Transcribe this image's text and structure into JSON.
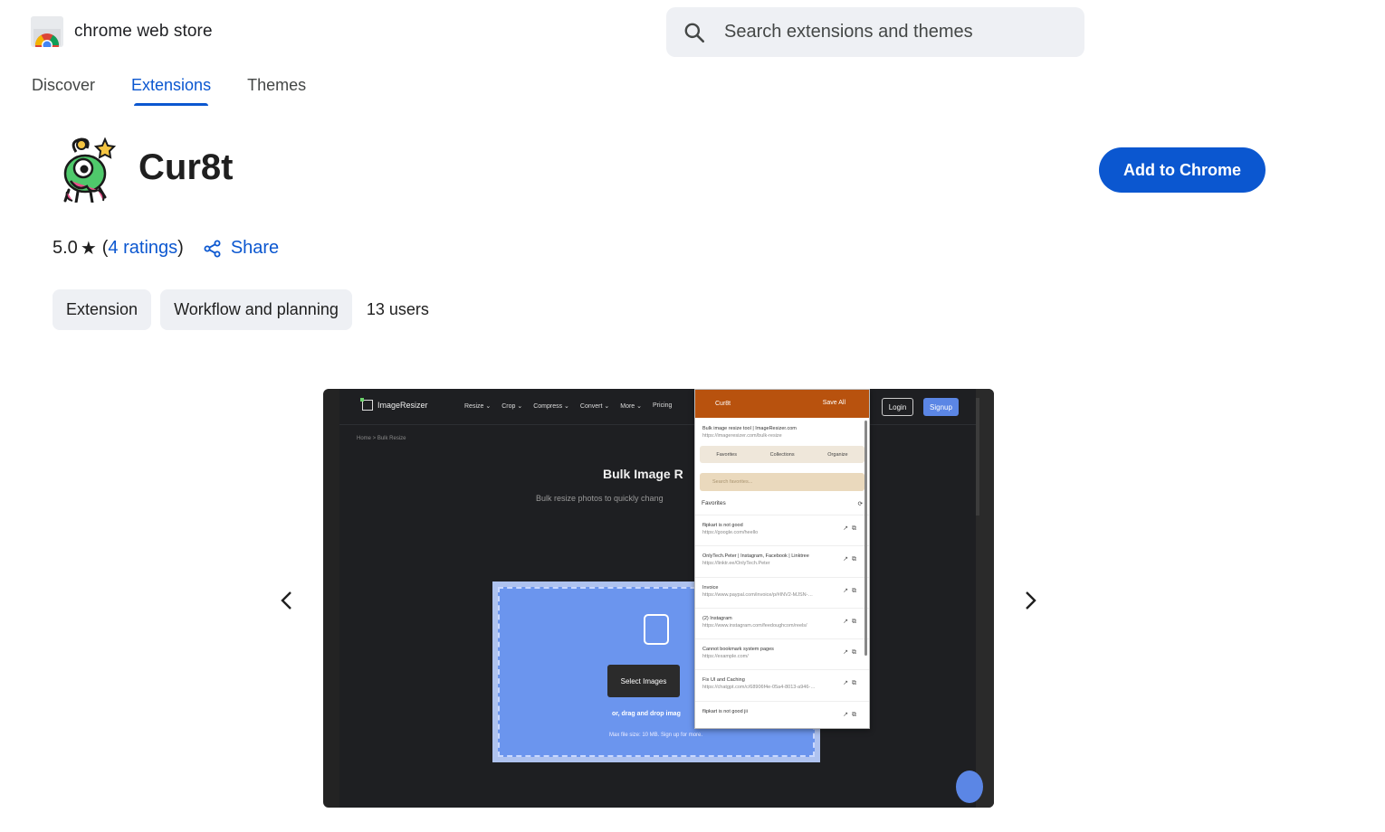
{
  "header": {
    "store_name": "chrome web store",
    "search_placeholder": "Search extensions and themes"
  },
  "nav": {
    "tabs": [
      {
        "label": "Discover",
        "active": false
      },
      {
        "label": "Extensions",
        "active": true
      },
      {
        "label": "Themes",
        "active": false
      }
    ]
  },
  "extension": {
    "name": "Cur8t",
    "add_button": "Add to Chrome",
    "rating": "5.0",
    "ratings_link": "4 ratings",
    "share_label": "Share",
    "chips": [
      "Extension",
      "Workflow and planning"
    ],
    "users": "13 users"
  },
  "screenshot": {
    "site_brand": "ImageResizer",
    "site_menu": [
      "Resize ⌄",
      "Crop ⌄",
      "Compress ⌄",
      "Convert ⌄",
      "More ⌄",
      "Pricing"
    ],
    "login": "Login",
    "signup": "Signup",
    "breadcrumb": "Home  >  Bulk Resize",
    "heading": "Bulk Image R",
    "subheading": "Bulk resize photos to quickly chang",
    "select_button": "Select Images",
    "drag_text": "or, drag and drop imag",
    "max_text": "Max file size: 10 MB. Sign up for more.",
    "popup": {
      "title": "Cur8t",
      "save_all": "Save All",
      "current_title": "Bulk image resize tool | ImageResizer.com",
      "current_url": "https://imageresizer.com/bulk-resize",
      "tabs": [
        "Favorites",
        "Collections",
        "Organize"
      ],
      "search_placeholder": "Search favorites...",
      "section": "Favorites",
      "items": [
        {
          "title": "flipkart is not good",
          "url": "https://google.com/heello"
        },
        {
          "title": "OnlyTech.Peter | Instagram, Facebook | Linktree",
          "url": "https://linktr.ee/OnlyTech.Peter"
        },
        {
          "title": "Invoice",
          "url": "https://www.paypal.com/invoice/p/#INV2-MJSN-E5G..."
        },
        {
          "title": "(2) Instagram",
          "url": "https://www.instagram.com/feedoughcom/reels/"
        },
        {
          "title": "Cannot bookmark system pages",
          "url": "https://example.com/"
        },
        {
          "title": "Fix UI and Caching",
          "url": "https://chatgpt.com/c/68906f4e-05a4-8013-a946-e5..."
        },
        {
          "title": "flipkart is not good jii",
          "url": ""
        }
      ]
    }
  },
  "colors": {
    "accent": "#0b57d0",
    "chip_bg": "#eef0f4",
    "popup_header": "#b8520e"
  }
}
